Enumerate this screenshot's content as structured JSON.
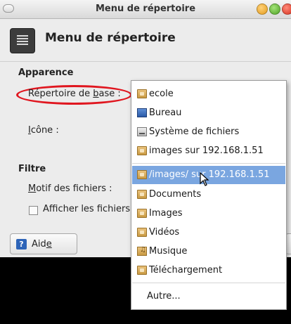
{
  "window": {
    "title": "Menu de répertoire",
    "heading": "Menu de répertoire"
  },
  "appearance": {
    "section_title": "Apparence",
    "base_dir_label_prefix": "Répertoire de ",
    "base_dir_label_underlined": "b",
    "base_dir_label_suffix": "ase :",
    "icon_label_underlined": "I",
    "icon_label_suffix": "cône :"
  },
  "filter": {
    "section_title": "Filtre",
    "pattern_label_underlined": "M",
    "pattern_label_suffix": "otif des fichiers :",
    "show_files_label": "Afficher les fichiers",
    "show_files_checked": false
  },
  "buttons": {
    "help_icon": "?",
    "help_label_prefix": "Aid",
    "help_label_underlined": "e"
  },
  "dropdown": {
    "items": [
      {
        "label": "ecole",
        "icon": "folder-icon"
      },
      {
        "label": "Bureau",
        "icon": "desktop-icon"
      },
      {
        "label": "Système de fichiers",
        "icon": "drive-icon"
      },
      {
        "label": "images sur 192.168.1.51",
        "icon": "network-folder-icon"
      },
      {
        "label": "/images/ sur 192.168.1.51",
        "icon": "network-folder-icon",
        "selected": true
      },
      {
        "label": "Documents",
        "icon": "folder-icon"
      },
      {
        "label": "Images",
        "icon": "folder-icon"
      },
      {
        "label": "Vidéos",
        "icon": "folder-icon"
      },
      {
        "label": "Musique",
        "icon": "music-folder-icon"
      },
      {
        "label": "Téléchargement",
        "icon": "download-folder-icon"
      },
      {
        "label": "Autre...",
        "icon": ""
      }
    ]
  },
  "colors": {
    "selection": "#7aa6e0",
    "annotation_red": "#e0161f"
  }
}
